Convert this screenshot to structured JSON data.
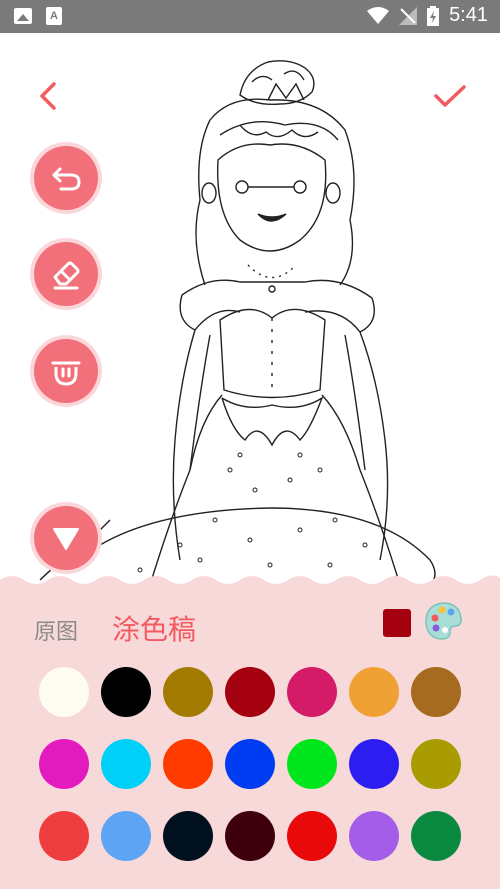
{
  "status_bar": {
    "time": "5:41"
  },
  "tools": [
    "undo",
    "eraser",
    "clear",
    "collapse"
  ],
  "tabs": {
    "original": "原图",
    "draft": "涂色稿"
  },
  "current_color": "#a4000f",
  "palette_colors": [
    "#fffdf3",
    "#000000",
    "#a37b00",
    "#a4000f",
    "#d41b68",
    "#f0a135",
    "#a66b20",
    "#e21bbf",
    "#00cff8",
    "#ff3b00",
    "#003cf2",
    "#00e61c",
    "#2c1df0",
    "#a89c00",
    "#ee3e3e",
    "#5ea4f4",
    "#00101e",
    "#3d000c",
    "#e80a0a",
    "#a35de8",
    "#0a8a3f"
  ]
}
